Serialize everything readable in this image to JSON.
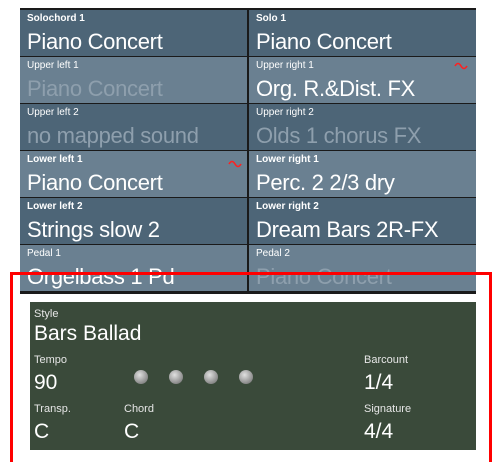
{
  "sounds": {
    "solochord1": {
      "label": "Solochord 1",
      "value": "Piano Concert"
    },
    "solo1": {
      "label": "Solo 1",
      "value": "Piano Concert"
    },
    "upper_left1": {
      "label": "Upper left 1",
      "value": "Piano Concert"
    },
    "upper_right1": {
      "label": "Upper right 1",
      "value": "Org. R.&Dist. FX"
    },
    "upper_left2": {
      "label": "Upper left 2",
      "value": "no mapped sound"
    },
    "upper_right2": {
      "label": "Upper right 2",
      "value": "Olds 1 chorus FX"
    },
    "lower_left1": {
      "label": "Lower left 1",
      "value": "Piano Concert"
    },
    "lower_right1": {
      "label": "Lower right 1",
      "value": "Perc. 2 2/3 dry"
    },
    "lower_left2": {
      "label": "Lower left 2",
      "value": "Strings slow 2"
    },
    "lower_right2": {
      "label": "Lower right 2",
      "value": "Dream Bars 2R-FX"
    },
    "pedal1": {
      "label": "Pedal 1",
      "value": "Orgelbass 1  Pd"
    },
    "pedal2": {
      "label": "Pedal 2",
      "value": "Piano Concert"
    }
  },
  "style_panel": {
    "style_label": "Style",
    "style_value": "Bars Ballad",
    "tempo_label": "Tempo",
    "tempo_value": "90",
    "barcount_label": "Barcount",
    "barcount_value": "1/4",
    "transp_label": "Transp.",
    "transp_value": "C",
    "chord_label": "Chord",
    "chord_value": "C",
    "signature_label": "Signature",
    "signature_value": "4/4"
  },
  "colors": {
    "cell_bg": "#4d6577",
    "cell_band": "#6a8091",
    "style_panel_bg": "#3a4a3a",
    "highlight_frame": "#ff0000",
    "wave_icon": "#ff2020"
  }
}
